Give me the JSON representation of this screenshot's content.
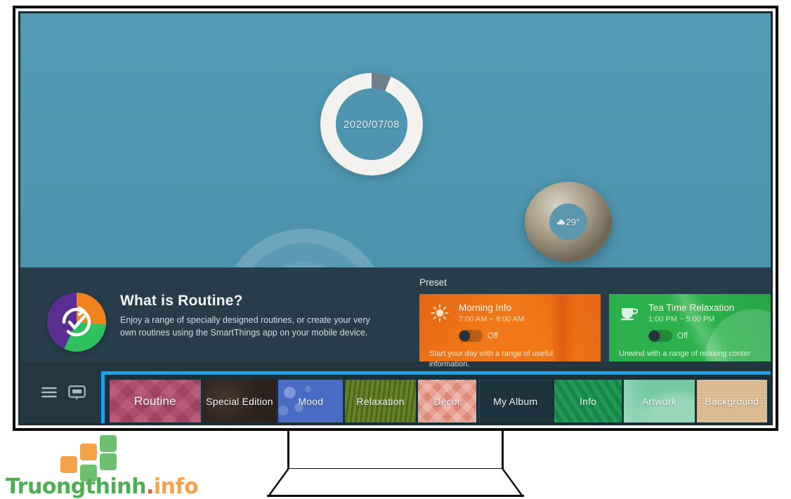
{
  "tv": {
    "widgets": {
      "date_ring": {
        "name": "date-ring-widget",
        "date": "2020/07/08"
      },
      "weather_ring": {
        "name": "weather-ring-widget",
        "temperature": "29°",
        "icon": "cloud-icon"
      }
    },
    "routine_info": {
      "icon": "routine-pie-icon",
      "title": "What is Routine?",
      "description": "Enjoy a range of specially designed routines, or create your very own routines using the SmartThings app on your mobile device."
    },
    "preset": {
      "label": "Preset",
      "cards": [
        {
          "icon": "sun-icon",
          "title": "Morning Info",
          "time": "7:00 AM ~ 9:00 AM",
          "toggle_state": "Off",
          "description": "Start your day with a range of useful information.",
          "color": "#f07818"
        },
        {
          "icon": "teacup-icon",
          "title": "Tea Time Relaxation",
          "time": "1:00 PM ~ 5:00 PM",
          "toggle_state": "Off",
          "description": "Unwind with a range of relaxing conter",
          "color": "#2bb24c"
        }
      ]
    },
    "bottom_bar": {
      "icons": [
        {
          "name": "hamburger-menu-icon"
        },
        {
          "name": "tv-source-icon"
        }
      ],
      "highlight_color": "#1ba1ee",
      "tabs": [
        {
          "label": "Routine",
          "selected": true,
          "color": "#b14a6b"
        },
        {
          "label": "Special Edition",
          "selected": false,
          "color": "#2c211d"
        },
        {
          "label": "Mood",
          "selected": false,
          "color": "#4a6bc4"
        },
        {
          "label": "Relaxation",
          "selected": false,
          "color": "#5d7a1e"
        },
        {
          "label": "Décor",
          "selected": false,
          "color": "#e08878"
        },
        {
          "label": "My Album",
          "selected": false,
          "color": "#1d333e"
        },
        {
          "label": "Info",
          "selected": false,
          "color": "#13914a"
        },
        {
          "label": "Artwork",
          "selected": false,
          "color": "#74c9a2"
        },
        {
          "label": "Background",
          "selected": false,
          "color": "#ddbd92"
        }
      ]
    }
  },
  "watermark": {
    "text_part1": "Truongthinh",
    "text_dot": ".",
    "text_part2": "info",
    "green": "#4caf50",
    "orange": "#f5a24b",
    "red": "#e8553a"
  }
}
